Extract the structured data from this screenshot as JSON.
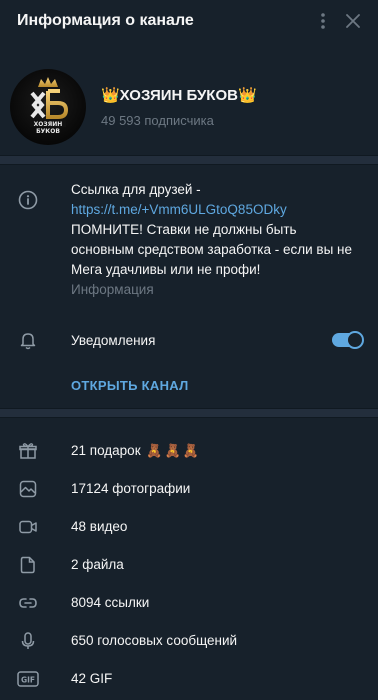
{
  "header": {
    "title": "Информация о канале"
  },
  "profile": {
    "name": "👑ХОЗЯИН БУКОВ👑",
    "subscribers": "49 593 подписчика",
    "avatar_logo_text": "ХОЗЯИН БУКОВ"
  },
  "about": {
    "line1": "Ссылка для друзей -",
    "link": "https://t.me/+Vmm6ULGtoQ85ODky",
    "body": "ПОМНИТЕ! Ставки не должны быть основным средством заработка - если вы не Мега удачливы или не профи!",
    "caption": "Информация"
  },
  "notifications": {
    "label": "Уведомления",
    "enabled": true
  },
  "open_channel": {
    "label": "ОТКРЫТЬ КАНАЛ"
  },
  "media": [
    {
      "icon": "gift-icon",
      "label": "21 подарок"
    },
    {
      "icon": "photo-icon",
      "label": "17124 фотографии"
    },
    {
      "icon": "video-icon",
      "label": "48 видео"
    },
    {
      "icon": "file-icon",
      "label": "2 файла"
    },
    {
      "icon": "link-icon",
      "label": "8094 ссылки"
    },
    {
      "icon": "microphone-icon",
      "label": "650 голосовых сообщений"
    },
    {
      "icon": "gif-icon",
      "label": "42 GIF"
    }
  ],
  "colors": {
    "background": "#17212b",
    "accent": "#5fa8e0",
    "muted": "#6d7883",
    "divider": "#232e3c"
  }
}
